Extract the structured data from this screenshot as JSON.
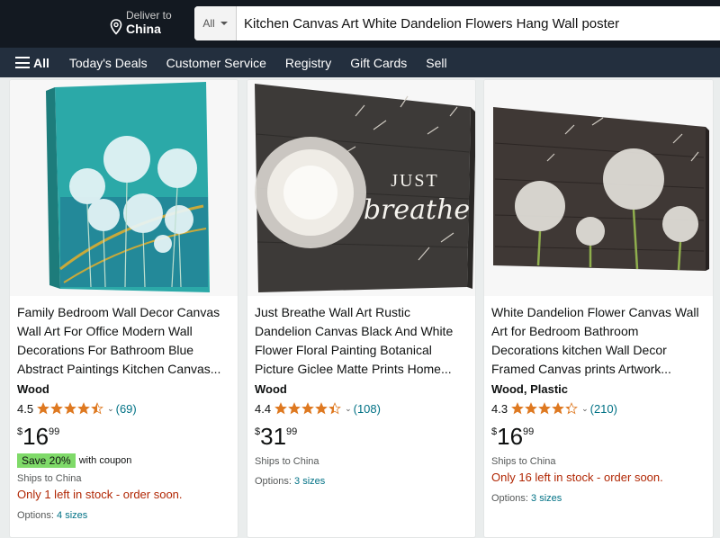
{
  "header": {
    "deliver_line1": "Deliver to",
    "deliver_line2": "China",
    "search_category": "All",
    "search_value": "Kitchen Canvas Art White Dandelion Flowers Hang Wall poster"
  },
  "nav": {
    "menu_label": "All",
    "items": [
      "Today's Deals",
      "Customer Service",
      "Registry",
      "Gift Cards",
      "Sell"
    ]
  },
  "colors": {
    "topbar": "#131921",
    "navbar": "#232f3e",
    "star": "#de7921",
    "link": "#007185",
    "stock_warning": "#b12704",
    "coupon_badge": "#7fda69"
  },
  "products": [
    {
      "title": "Family Bedroom Wall Decor Canvas Wall Art For Office Modern Wall Decorations For Bathroom Blue Abstract Paintings Kitchen Canvas...",
      "material": "Wood",
      "rating": "4.5",
      "stars_value": 4.5,
      "review_count": "(69)",
      "price_symbol": "$",
      "price_whole": "16",
      "price_fraction": "99",
      "coupon_badge": "Save 20%",
      "coupon_text": "with coupon",
      "ships": "Ships to China",
      "stock": "Only 1 left in stock - order soon.",
      "options_label": "Options:",
      "options_link": "4 sizes"
    },
    {
      "title": "Just Breathe Wall Art Rustic Dandelion Canvas Black And White Flower Floral Painting Botanical Picture Giclee Matte Prints Home...",
      "material": "Wood",
      "rating": "4.4",
      "stars_value": 4.4,
      "review_count": "(108)",
      "price_symbol": "$",
      "price_whole": "31",
      "price_fraction": "99",
      "ships": "Ships to China",
      "options_label": "Options:",
      "options_link": "3 sizes",
      "image_text_1": "JUST",
      "image_text_2": "breathe"
    },
    {
      "title": "White Dandelion Flower Canvas Wall Art for Bedroom Bathroom Decorations kitchen Wall Decor Framed Canvas prints Artwork...",
      "material": "Wood, Plastic",
      "rating": "4.3",
      "stars_value": 4.3,
      "review_count": "(210)",
      "price_symbol": "$",
      "price_whole": "16",
      "price_fraction": "99",
      "ships": "Ships to China",
      "stock": "Only 16 left in stock - order soon.",
      "options_label": "Options:",
      "options_link": "3 sizes"
    }
  ]
}
